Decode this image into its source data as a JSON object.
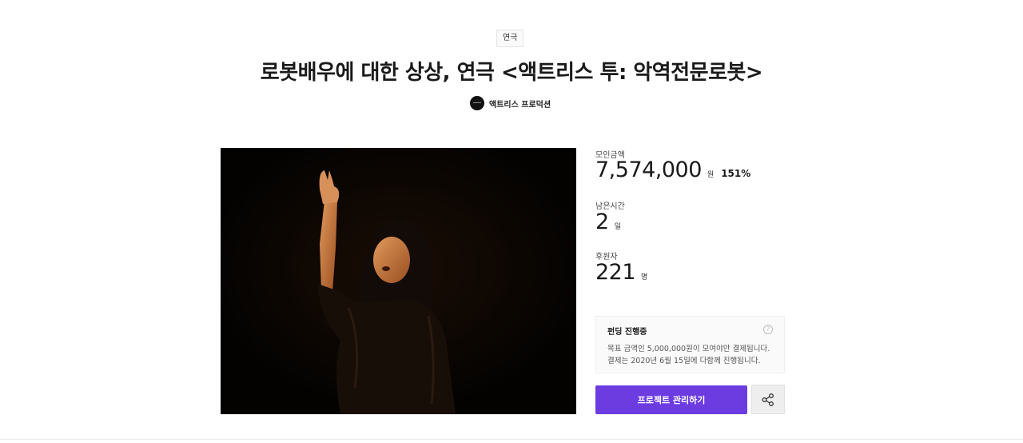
{
  "header": {
    "category": "연극",
    "title": "로봇배우에 대한 상상, 연극 <액트리스 투: 악역전문로봇>",
    "creator_name": "액트리스 프로덕션"
  },
  "stats": {
    "raised_label": "모인금액",
    "raised_amount": "7,574,000",
    "raised_unit": "원",
    "raised_percent": "151%",
    "time_label": "남은시간",
    "time_value": "2",
    "time_unit": "일",
    "backers_label": "후원자",
    "backers_value": "221",
    "backers_unit": "명"
  },
  "funding_info": {
    "title": "펀딩 진행중",
    "line1": "목표 금액인 5,000,000원이 모여야만 결제됩니다.",
    "line2": "결제는 2020년 6월 15일에 다함께 진행됩니다.",
    "help_icon": "?"
  },
  "actions": {
    "manage_label": "프로젝트 관리하기",
    "share_icon": "share-icon"
  },
  "colors": {
    "accent": "#6c3ce1",
    "image_bg": "#050302"
  }
}
